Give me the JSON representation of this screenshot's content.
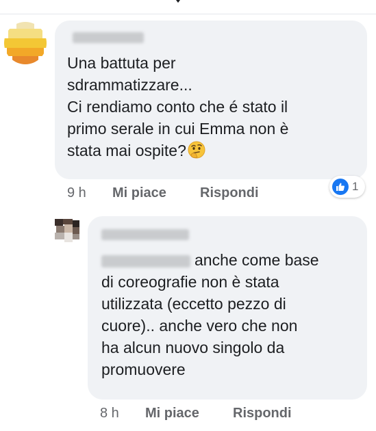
{
  "comment": {
    "text": "Una battuta per\nsdrammatizzare...\nCi rendiamo conto che é stato il\nprimo serale in cui Emma non è\nstata mai ospite?",
    "emoji": "thinking-face",
    "time": "9 h",
    "like_label": "Mi piace",
    "reply_label": "Rispondi",
    "reaction": {
      "type": "like",
      "count": "1",
      "color": "#1877f2"
    }
  },
  "reply": {
    "text": "anche come base\ndi coreografie non è stata\nutilizzata (eccetto pezzo di\ncuore).. anche vero che non\nha alcun nuovo singolo da\npromuovere",
    "time": "8 h",
    "like_label": "Mi piace",
    "reply_label": "Rispondi"
  },
  "colors": {
    "bubble": "#f0f2f5",
    "meta_text": "#65676b",
    "body_text": "#1c1e21",
    "accent": "#1877f2"
  }
}
